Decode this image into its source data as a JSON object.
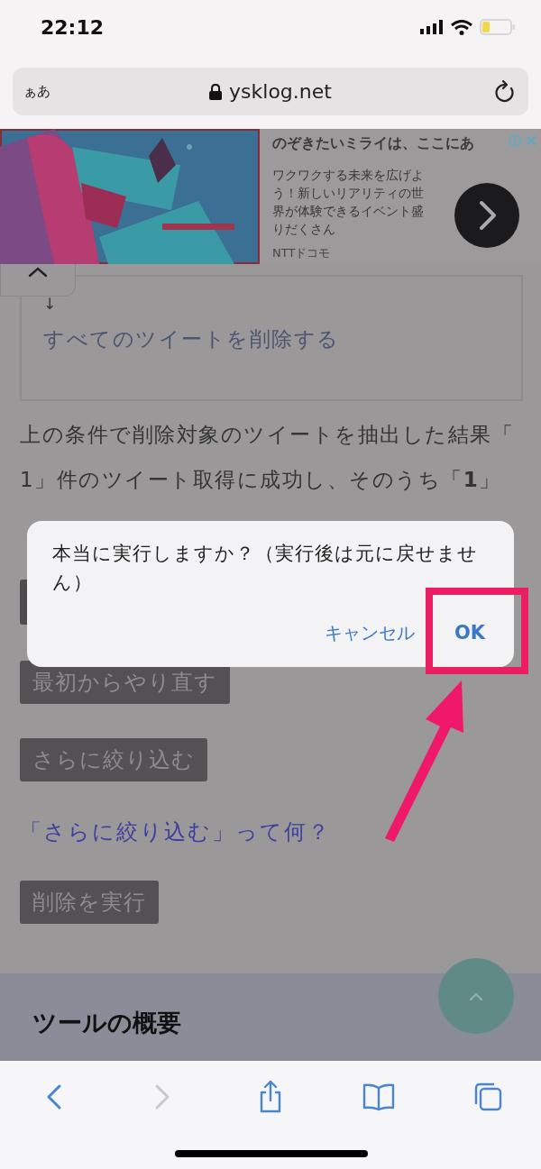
{
  "status_bar": {
    "time": "22:12"
  },
  "address_bar": {
    "text_size": "ぁあ",
    "url": "ysklog.net"
  },
  "ad": {
    "kind": "picture",
    "title": "のぞきたいミライは、ここにあ",
    "body": "ワクワクする未来を広げよう！新しいリアリティの世界が体験できるイベント盛りだくさん",
    "sponsor": "NTTドコモ"
  },
  "quote_box": {
    "arrow": "↓",
    "text": "すべてのツイートを削除する"
  },
  "paragraph": "上の条件で削除対象のツイートを抽出した結果「1」件のツイート取得に成功し、そのうち「**1**」",
  "dialog": {
    "message": "本当に実行しますか？（実行後は元に戻せません）",
    "buttons": [
      {
        "label": "キャンセル",
        "kind": "cancel"
      },
      {
        "label": "OK",
        "kind": "default"
      }
    ]
  },
  "buttons": [
    "最初からやり直す",
    "さらに絞り込む"
  ],
  "help_link": "「さらに絞り込む」って何？",
  "execute_button": "削除を実行",
  "section_heading": "ツールの概要",
  "toolbar": [
    {
      "kind": "back",
      "disabled": false
    },
    {
      "kind": "forward",
      "disabled": true
    },
    {
      "kind": "share",
      "disabled": false
    },
    {
      "kind": "bookmarks",
      "disabled": false
    },
    {
      "kind": "tabs",
      "disabled": false
    }
  ]
}
